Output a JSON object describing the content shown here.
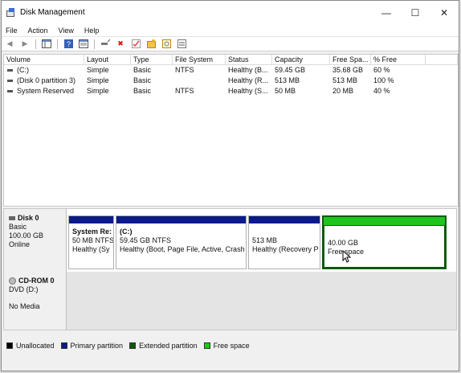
{
  "window": {
    "title": "Disk Management"
  },
  "menu": [
    "File",
    "Action",
    "View",
    "Help"
  ],
  "columns": [
    "Volume",
    "Layout",
    "Type",
    "File System",
    "Status",
    "Capacity",
    "Free Spa...",
    "% Free"
  ],
  "volumes": [
    {
      "volume": "(C:)",
      "layout": "Simple",
      "type": "Basic",
      "fs": "NTFS",
      "status": "Healthy (B...",
      "capacity": "59.45 GB",
      "free": "35.68 GB",
      "pct": "60 %"
    },
    {
      "volume": "(Disk 0 partition 3)",
      "layout": "Simple",
      "type": "Basic",
      "fs": "",
      "status": "Healthy (R...",
      "capacity": "513 MB",
      "free": "513 MB",
      "pct": "100 %"
    },
    {
      "volume": "System Reserved",
      "layout": "Simple",
      "type": "Basic",
      "fs": "NTFS",
      "status": "Healthy (S...",
      "capacity": "50 MB",
      "free": "20 MB",
      "pct": "40 %"
    }
  ],
  "disk0": {
    "name": "Disk 0",
    "type": "Basic",
    "size": "100.00 GB",
    "state": "Online",
    "partitions": [
      {
        "name": "System Re:",
        "line1": "50 MB NTFS",
        "line2": "Healthy (Sy"
      },
      {
        "name": "(C:)",
        "line1": "59.45 GB NTFS",
        "line2": "Healthy (Boot, Page File, Active, Crash"
      },
      {
        "name": "",
        "line1": "513 MB",
        "line2": "Healthy (Recovery P"
      },
      {
        "name": "",
        "line1": "40.00 GB",
        "line2": "Free space"
      }
    ]
  },
  "cdrom": {
    "name": "CD-ROM 0",
    "drive": "DVD (D:)",
    "media": "No Media"
  },
  "legend": [
    {
      "label": "Unallocated",
      "color": "#000000"
    },
    {
      "label": "Primary partition",
      "color": "#0a1a88"
    },
    {
      "label": "Extended partition",
      "color": "#0c5a0c"
    },
    {
      "label": "Free space",
      "color": "#1fc41f"
    }
  ],
  "icons": {
    "minimize": "—",
    "maximize": "☐",
    "close": "✕",
    "back": "◀",
    "forward": "▶",
    "delete": "✖"
  }
}
